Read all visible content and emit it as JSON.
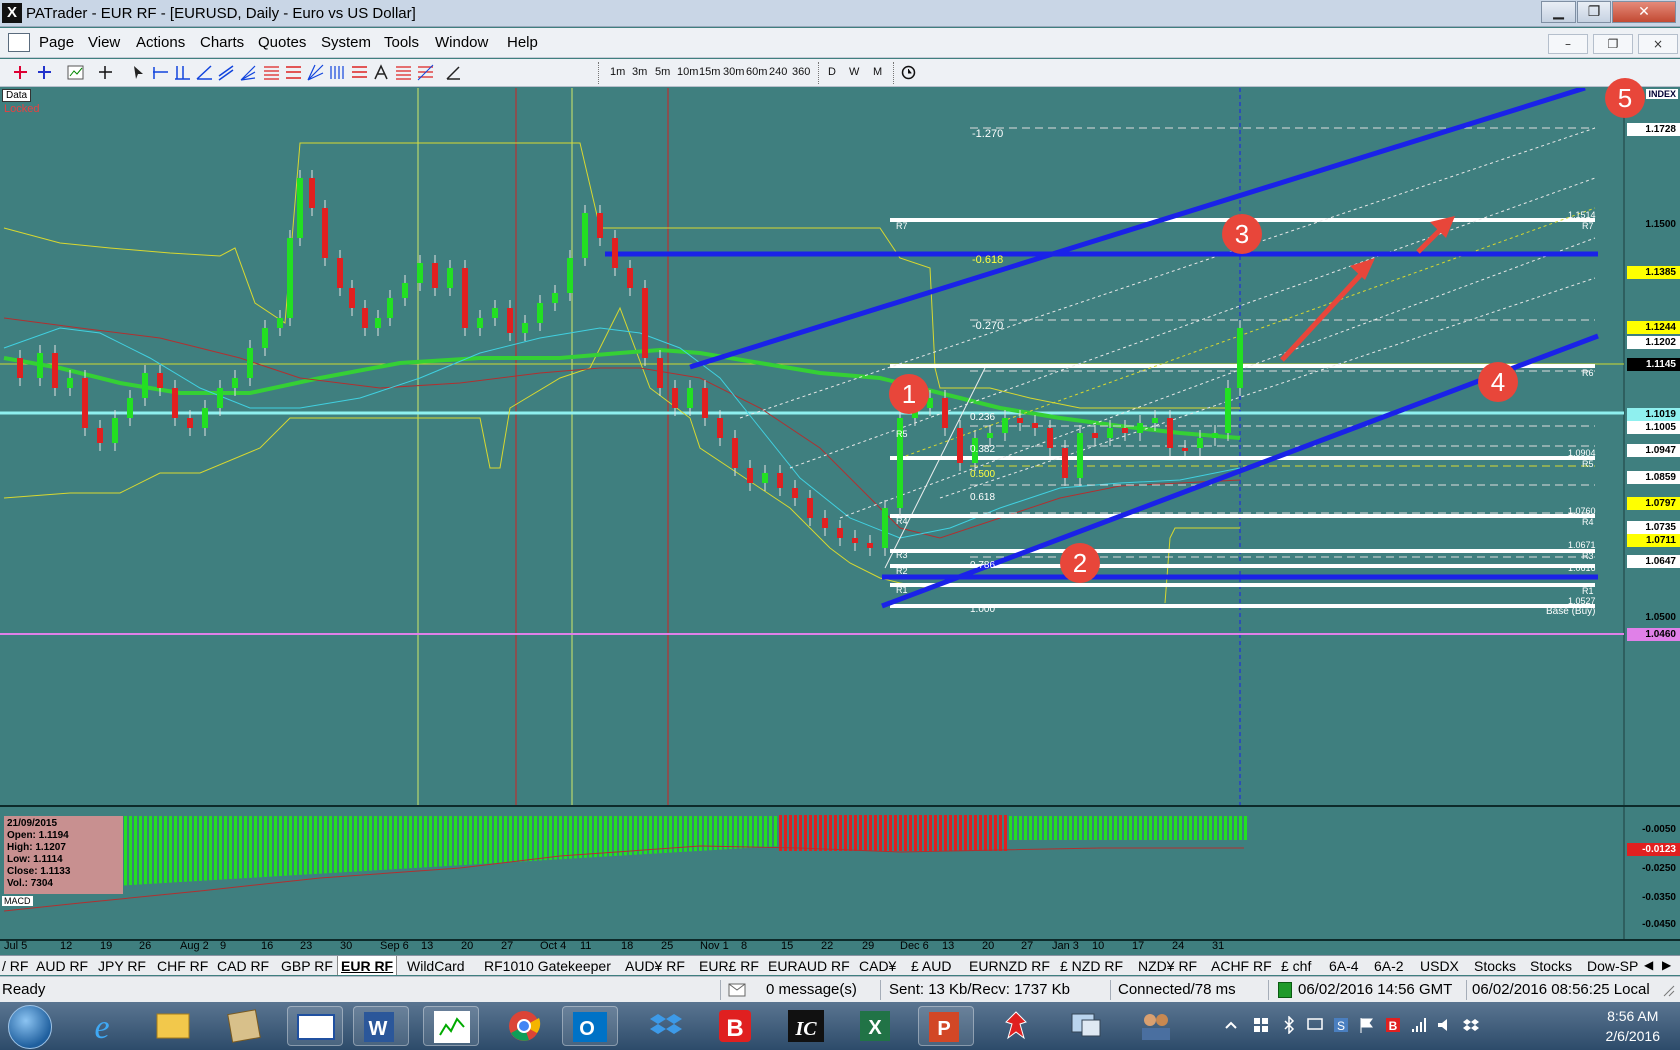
{
  "window": {
    "title": "PATrader - EUR RF - [EURUSD, Daily - Euro vs US Dollar]",
    "logo": "X",
    "minimize": "▁",
    "restore": "❐",
    "close": "✕"
  },
  "menu": [
    "Page",
    "View",
    "Actions",
    "Charts",
    "Quotes",
    "System",
    "Tools",
    "Window",
    "Help"
  ],
  "mdi": {
    "minimize": "–",
    "restore": "❐",
    "close": "×"
  },
  "toolbar": {
    "timeframes": [
      "1m",
      "3m",
      "5m",
      "10m",
      "15m",
      "30m",
      "60m",
      "240",
      "360"
    ],
    "periods": [
      "D",
      "W",
      "M"
    ]
  },
  "chart": {
    "data_label": "Data",
    "locked_label": "Locked",
    "index_label": "INDEX",
    "price_axis": [
      "1.1728",
      "1.1500",
      "1.1385",
      "1.1244",
      "1.1202",
      "1.1145",
      "1.1019",
      "1.1005",
      "1.0947",
      "1.0859",
      "1.0797",
      "1.0735",
      "1.0711",
      "1.0647",
      "1.0500",
      "1.0460"
    ],
    "pivot_labels": [
      "R7",
      "R6",
      "R5",
      "R4",
      "R3",
      "R2",
      "R1",
      "Base (Buy)"
    ],
    "pivot_values": [
      "1.1514",
      "1.0904",
      "1.0760",
      "1.0671",
      "1.0616",
      "1.0527"
    ],
    "fib_labels": [
      "-1.270",
      "-0.618",
      "-0.270",
      "0.236",
      "0.382",
      "0.500",
      "0.618",
      "0.786",
      "1.000"
    ],
    "markers": [
      "1",
      "2",
      "3",
      "4",
      "5"
    ],
    "x_labels": [
      "Jul 5",
      "12",
      "19",
      "26",
      "Aug 2",
      "9",
      "16",
      "23",
      "30",
      "Sep 6",
      "13",
      "20",
      "27",
      "Oct 4",
      "11",
      "18",
      "25",
      "Nov 1",
      "8",
      "15",
      "22",
      "29",
      "Dec 6",
      "13",
      "20",
      "27",
      "Jan 3",
      "10",
      "17",
      "24",
      "31"
    ],
    "ohlc": {
      "date": "21/09/2015",
      "open": "Open: 1.1194",
      "high": "High: 1.1207",
      "low": "Low: 1.1114",
      "close": "Close: 1.1133",
      "vol": "Vol.: 7304"
    },
    "macd_label": "MACD",
    "macd_axis": [
      "-0.0050",
      "-0.0123",
      "-0.0250",
      "-0.0350",
      "-0.0450"
    ]
  },
  "tabs": [
    "/ RF",
    "AUD RF",
    "JPY RF",
    "CHF RF",
    "CAD RF",
    "GBP RF",
    "EUR RF",
    "WildCard",
    "RF1010 Gatekeeper",
    "AUD¥ RF",
    "EUR£ RF",
    "EURAUD RF",
    "CAD¥",
    "£ AUD",
    "EURNZD RF",
    "£ NZD RF",
    "NZD¥ RF",
    "ACHF RF",
    "£ chf",
    "6A-4",
    "6A-2",
    "USDX",
    "Stocks",
    "Stocks",
    "Dow-SP"
  ],
  "active_tab": "EUR RF",
  "status": {
    "ready": "Ready",
    "messages": "0 message(s)",
    "traffic": "Sent: 13 Kb/Recv: 1737 Kb",
    "connection": "Connected/78 ms",
    "gmt": "06/02/2016 14:56 GMT",
    "local": "06/02/2016 08:56:25 Local"
  },
  "taskbar": {
    "time": "8:56 AM",
    "date": "2/6/2016"
  },
  "colors": {
    "chart_bg": "#3f7f7f",
    "bull": "#22e022",
    "bear": "#e02020",
    "channel": "#1a22e8",
    "marker": "#e8463a"
  }
}
